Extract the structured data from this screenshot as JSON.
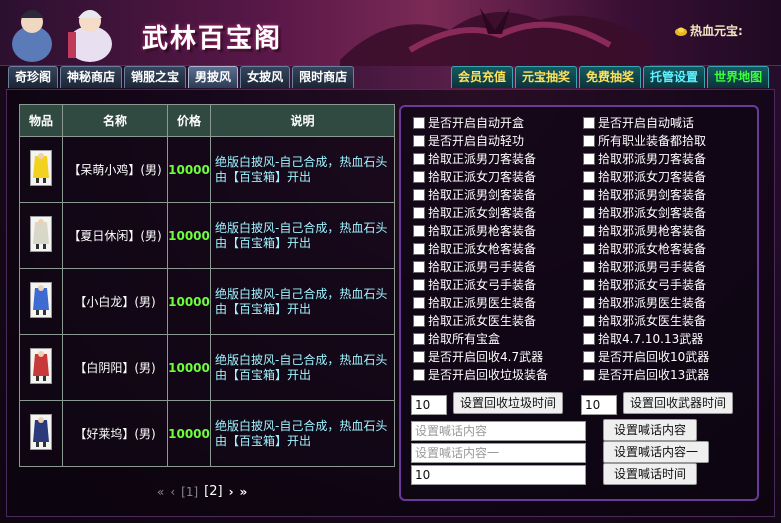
{
  "banner": {
    "title": "武林百宝阁",
    "coin_label": "热血元宝:"
  },
  "tabs_left": [
    "奇珍阁",
    "神秘商店",
    "销服之宝",
    "男披风",
    "女披风",
    "限时商店"
  ],
  "tabs_left_active": "男披风",
  "tabs_right": [
    {
      "label": "会员充值",
      "color": "yellow"
    },
    {
      "label": "元宝抽奖",
      "color": "yellow"
    },
    {
      "label": "免费抽奖",
      "color": "yellow"
    },
    {
      "label": "托管设置",
      "color": "cyan"
    },
    {
      "label": "世界地图",
      "color": "green"
    }
  ],
  "table": {
    "headers": [
      "物品",
      "名称",
      "价格",
      "说明"
    ],
    "rows": [
      {
        "name": "【呆萌小鸡】(男)",
        "price": "10000",
        "desc": "绝版白披风-自己合成，热血石头由【百宝箱】开出",
        "icon": "chick-cape-icon",
        "icon_color": "#f2d21e"
      },
      {
        "name": "【夏日休闲】(男)",
        "price": "10000",
        "desc": "绝版白披风-自己合成，热血石头由【百宝箱】开出",
        "icon": "summer-cape-icon",
        "icon_color": "#d8d8c8"
      },
      {
        "name": "【小白龙】(男)",
        "price": "10000",
        "desc": "绝版白披风-自己合成，热血石头由【百宝箱】开出",
        "icon": "dragon-cape-icon",
        "icon_color": "#3d6bd2"
      },
      {
        "name": "【白阴阳】(男)",
        "price": "10000",
        "desc": "绝版白披风-自己合成，热血石头由【百宝箱】开出",
        "icon": "yinyang-cape-icon",
        "icon_color": "#c83a3a"
      },
      {
        "name": "【好莱坞】(男)",
        "price": "10000",
        "desc": "绝版白披风-自己合成，热血石头由【百宝箱】开出",
        "icon": "hollywood-cape-icon",
        "icon_color": "#2a3a7a"
      }
    ]
  },
  "pager": {
    "first": "«",
    "prev": "‹",
    "page1": "[1]",
    "page2": "[2]",
    "next": "›",
    "last": "»"
  },
  "settings": {
    "left_checks": [
      "是否开启自动开盒",
      "是否开启自动轻功",
      "拾取正派男刀客装备",
      "拾取正派女刀客装备",
      "拾取正派男剑客装备",
      "拾取正派女剑客装备",
      "拾取正派男枪客装备",
      "拾取正派女枪客装备",
      "拾取正派男弓手装备",
      "拾取正派女弓手装备",
      "拾取正派男医生装备",
      "拾取正派女医生装备",
      "拾取所有宝盒",
      "是否开启回收4.7武器",
      "是否开启回收垃圾装备"
    ],
    "right_checks": [
      "是否开启自动喊话",
      "所有职业装备都拾取",
      "拾取邪派男刀客装备",
      "拾取邪派女刀客装备",
      "拾取邪派男剑客装备",
      "拾取邪派女剑客装备",
      "拾取邪派男枪客装备",
      "拾取邪派女枪客装备",
      "拾取邪派男弓手装备",
      "拾取邪派女弓手装备",
      "拾取邪派男医生装备",
      "拾取邪派女医生装备",
      "拾取4.7.10.13武器",
      "是否开启回收10武器",
      "是否开启回收13武器"
    ],
    "junk_time_value": "10",
    "junk_time_btn": "设置回收垃圾时间",
    "weapon_time_value": "10",
    "weapon_time_btn": "设置回收武器时间",
    "shout1_placeholder": "设置喊话内容",
    "shout1_btn": "设置喊话内容",
    "shout2_placeholder": "设置喊话内容一",
    "shout2_btn": "设置喊话内容一",
    "shout_time_value": "10",
    "shout_time_btn": "设置喊话时间"
  }
}
